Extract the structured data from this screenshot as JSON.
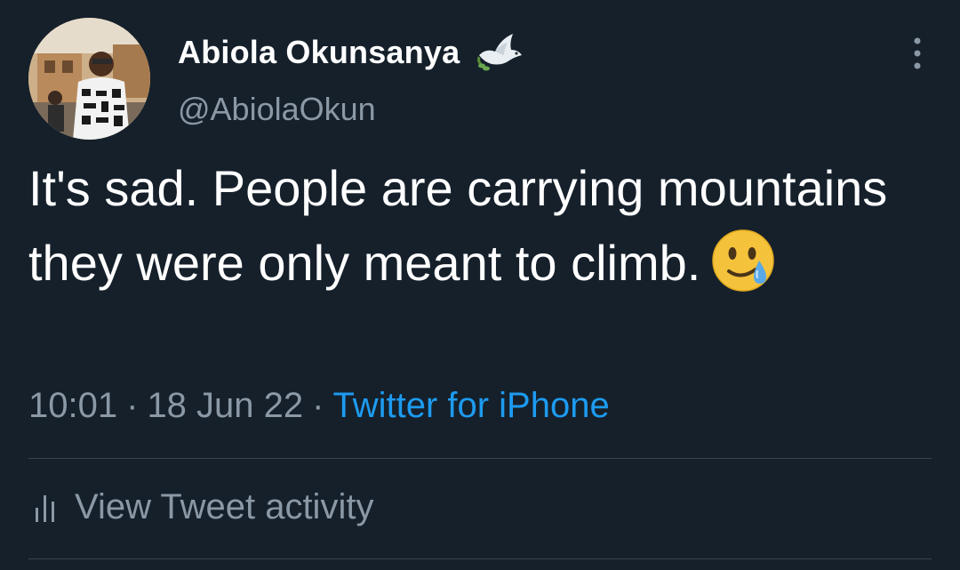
{
  "tweet": {
    "author": {
      "display_name": "Abiola Okunsanya",
      "handle": "@AbiolaOkun",
      "name_emoji_icon": "dove-icon",
      "avatar_icon": "avatar"
    },
    "text_before_emoji": "It's sad. People are carrying mountains they were only meant to climb.",
    "emoji_icon": "face-holding-back-tears-icon",
    "time": "10:01",
    "separator": "·",
    "date": "18 Jun 22",
    "source": "Twitter for iPhone",
    "more_icon": "more-options-icon"
  },
  "activity": {
    "label": "View Tweet activity",
    "icon": "activity-bars-icon"
  },
  "colors": {
    "background": "#15202b",
    "text_primary": "#ffffff",
    "text_secondary": "#8b98a5",
    "link": "#1d9bf0",
    "divider": "#38444d"
  }
}
